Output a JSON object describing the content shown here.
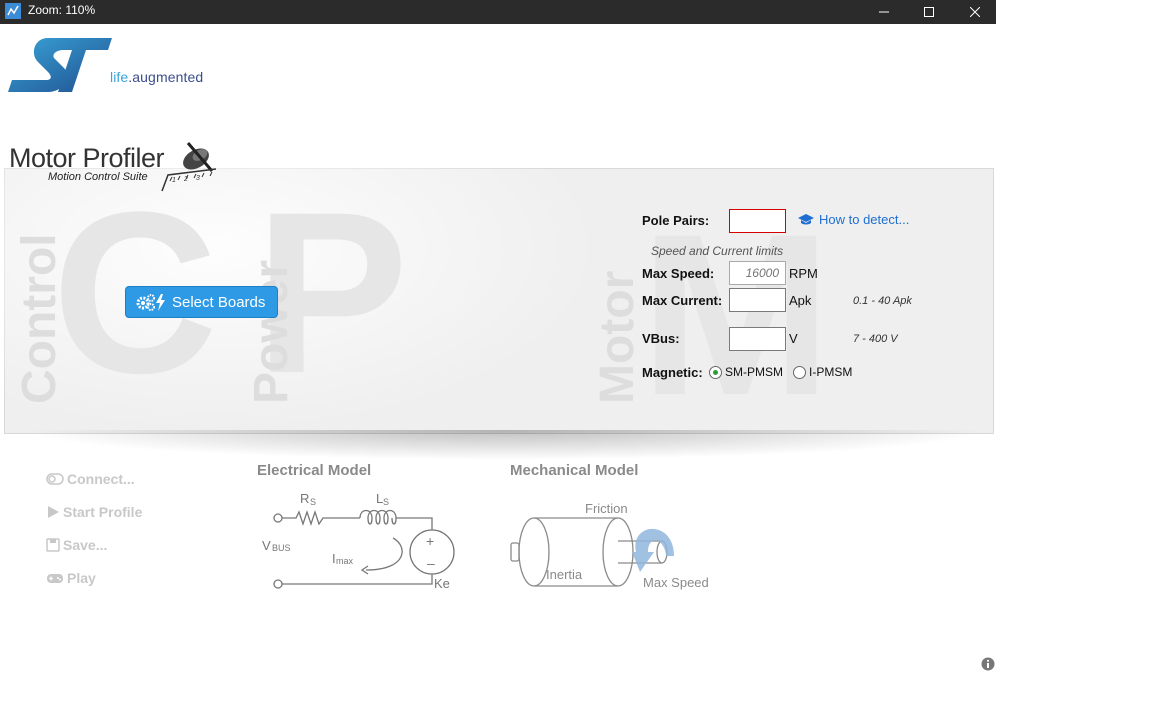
{
  "window": {
    "title": "Zoom: 110%"
  },
  "brand": {
    "tagline_prefix": "life",
    "tagline_suffix": ".augmented"
  },
  "app": {
    "title": "Motor Profiler",
    "subtitle": "Motion Control Suite"
  },
  "background_letters": {
    "control": "Control",
    "power": "Power",
    "motor": "Motor"
  },
  "select_boards": {
    "label": "Select Boards"
  },
  "form": {
    "pole_pairs": {
      "label": "Pole Pairs:",
      "value": ""
    },
    "how_to_detect": "How to detect...",
    "limits_heading": "Speed and Current limits",
    "max_speed": {
      "label": "Max Speed:",
      "placeholder": "16000",
      "unit": "RPM"
    },
    "max_current": {
      "label": "Max Current:",
      "value": "",
      "unit": "Apk",
      "range": "0.1 - 40 Apk"
    },
    "vbus": {
      "label": "VBus:",
      "value": "",
      "unit": "V",
      "range": "7 - 400 V"
    },
    "magnetic": {
      "label": "Magnetic:",
      "options": [
        "SM-PMSM",
        "I-PMSM"
      ],
      "selected": "SM-PMSM"
    }
  },
  "side_actions": {
    "connect": "Connect...",
    "start_profile": "Start Profile",
    "save": "Save...",
    "play": "Play"
  },
  "electrical_model": {
    "title": "Electrical Model",
    "rs": "R",
    "rs_sub": "S",
    "ls": "L",
    "ls_sub": "S",
    "vbus": "V",
    "vbus_sub": "BUS",
    "imax": "I",
    "imax_sub": "max",
    "ke": "Ke",
    "plus": "+",
    "minus": "–"
  },
  "mechanical_model": {
    "title": "Mechanical Model",
    "friction": "Friction",
    "inertia": "Inertia",
    "max_speed": "Max Speed"
  },
  "colors": {
    "accent": "#2e9ae6",
    "link": "#1e6fd0",
    "error_border": "#d40000",
    "brand_dark": "#3a4e8c",
    "brand_light": "#3aa4d8"
  }
}
